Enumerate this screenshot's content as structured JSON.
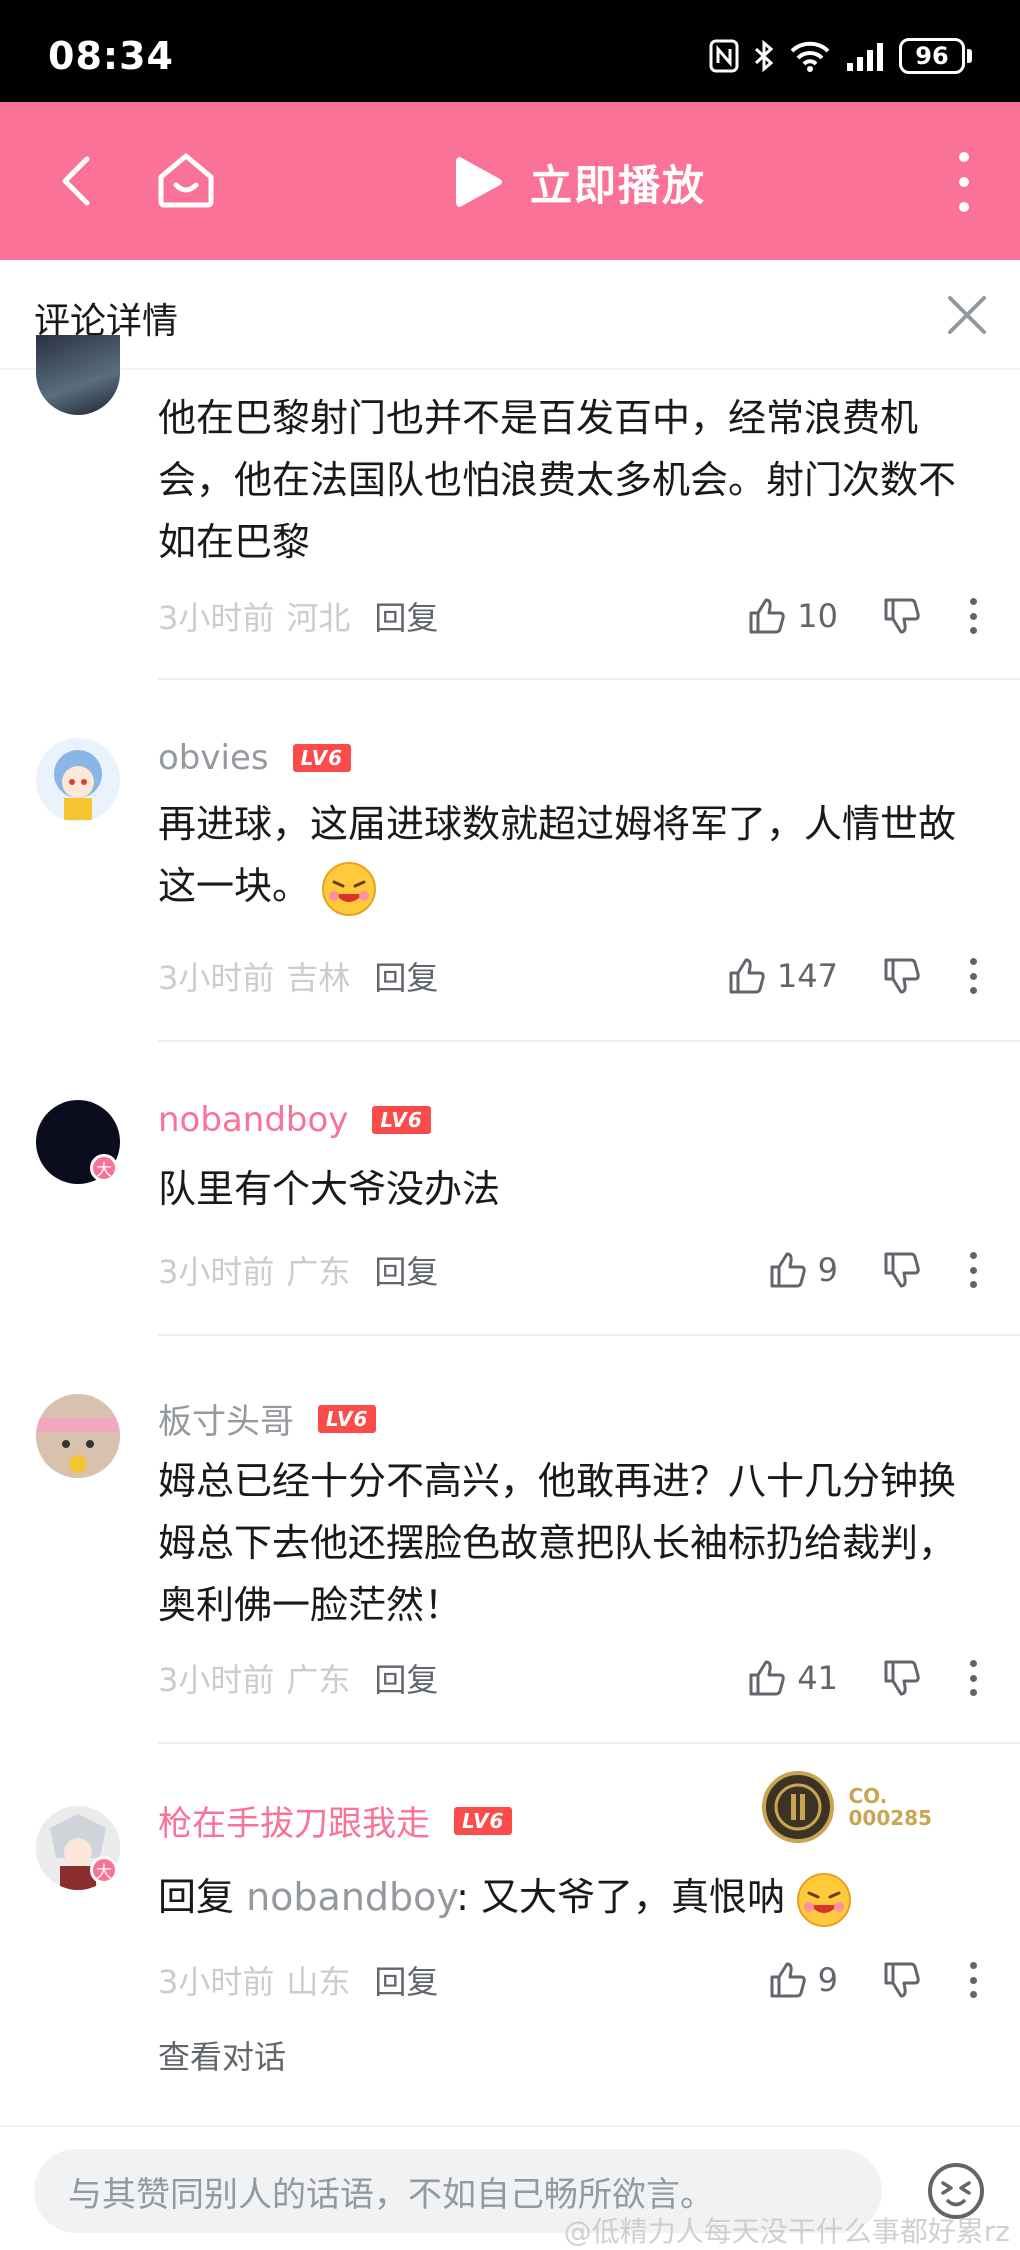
{
  "status_bar": {
    "time": "08:34",
    "battery": "96"
  },
  "top_bar": {
    "play_label": "立即播放",
    "accent_color": "#fb7299"
  },
  "panel": {
    "title": "评论详情"
  },
  "comments": [
    {
      "text": "他在巴黎射门也并不是百发百中，经常浪费机会，他在法国队也怕浪费太多机会。射门次数不如在巴黎",
      "time": "3小时前",
      "location": "河北",
      "reply": "回复",
      "likes": "10"
    },
    {
      "name": "obvies",
      "level": "LV6",
      "text": "再进球，这届进球数就超过姆将军了，人情世故这一块。",
      "time": "3小时前",
      "location": "吉林",
      "reply": "回复",
      "likes": "147"
    },
    {
      "name": "nobandboy",
      "level": "LV6",
      "badge": "大",
      "text": "队里有个大爷没办法",
      "time": "3小时前",
      "location": "广东",
      "reply": "回复",
      "likes": "9"
    },
    {
      "name": "板寸头哥",
      "level": "LV6",
      "text": "姆总已经十分不高兴，他敢再进？八十几分钟换姆总下去他还摆脸色故意把队长袖标扔给裁判，奥利佛一脸茫然！",
      "time": "3小时前",
      "location": "广东",
      "reply": "回复",
      "likes": "41"
    },
    {
      "name": "枪在手拔刀跟我走",
      "level": "LV6",
      "badge": "大",
      "reply_prefix": "回复 ",
      "reply_target": "nobandboy",
      "text": ": 又大爷了，真恨呐",
      "time": "3小时前",
      "location": "山东",
      "reply": "回复",
      "likes": "9",
      "medal_line1": "CO.",
      "medal_line2": "000285"
    }
  ],
  "view_conversation": "查看对话",
  "bottom_bar": {
    "placeholder": "与其赞同别人的话语，不如自己畅所欲言。"
  },
  "watermark": "@低精力人每天没干什么事都好累rz"
}
